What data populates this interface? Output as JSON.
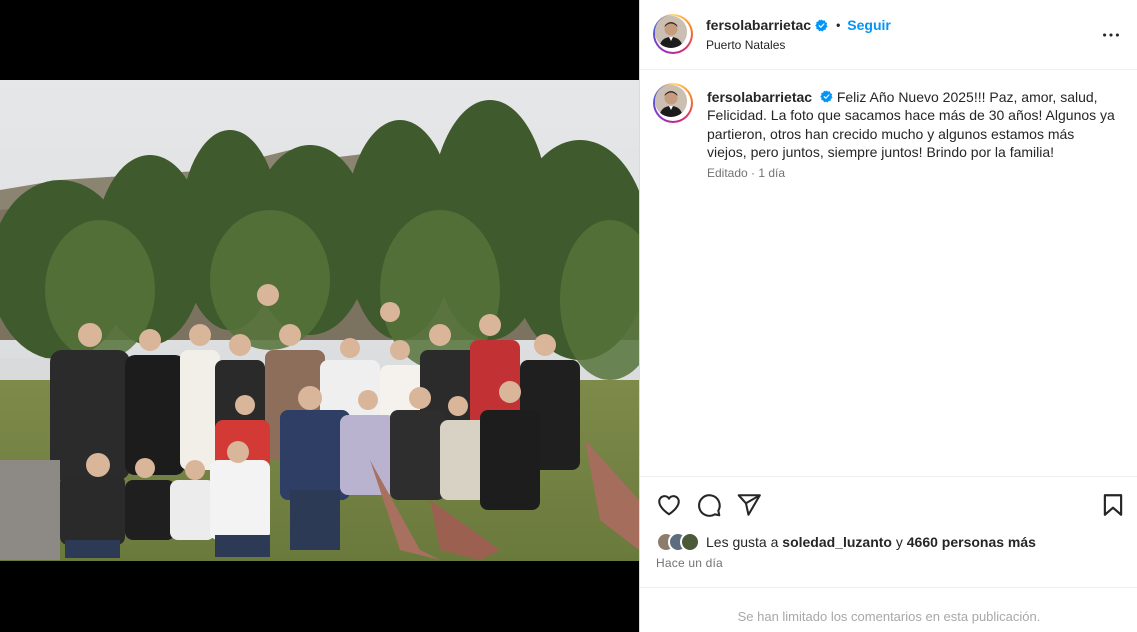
{
  "post": {
    "username": "fersolabarrietac",
    "follow_label": "Seguir",
    "location": "Puerto Natales",
    "caption": "Feliz Año Nuevo 2025!!! Paz, amor, salud, Felicidad. La foto que sacamos hace más de 30 años! Algunos ya partieron, otros han crecido mucho y algunos estamos más viejos, pero juntos, siempre juntos! Brindo por la familia!",
    "edited": "Editado",
    "edited_sep": " · ",
    "edited_time": "1 día",
    "likes_prefix": "Les gusta a",
    "liked_by": "soledad_luzanto",
    "likes_connector": "y",
    "likes_others": "4660 personas más",
    "timestamp": "Hace un día",
    "comments_notice": "Se han limitado los comentarios en esta publicación."
  },
  "icons": {
    "verified": "verified-badge-icon",
    "more": "more-options-icon",
    "like": "heart-icon",
    "comment": "comment-icon",
    "share": "paper-plane-icon",
    "save": "bookmark-icon"
  },
  "colors": {
    "link": "#0095f6",
    "verified": "#0095f6",
    "secondary_text": "#737373",
    "muted_text": "#a8a8a8"
  }
}
